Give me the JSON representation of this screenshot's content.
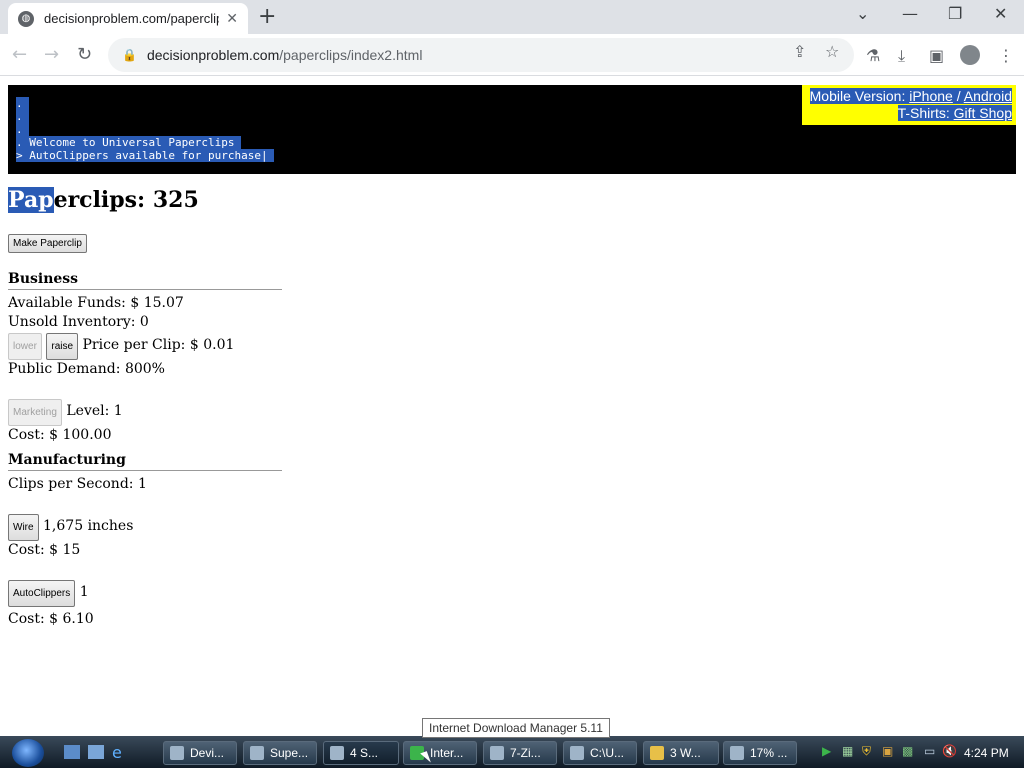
{
  "browser": {
    "tab_title": "decisionproblem.com/paperclips",
    "url_domain": "decisionproblem.com",
    "url_path": "/paperclips/index2.html"
  },
  "console": {
    "lines": [
      ".",
      ".",
      ".",
      ". Welcome to Universal Paperclips",
      "> AutoClippers available for purchase|"
    ]
  },
  "links": {
    "mobile_label": "Mobile Version:",
    "iphone": "iPhone",
    "sep": "/",
    "android": "Android",
    "tshirts_label": "T-Shirts:",
    "gift_shop": "Gift Shop"
  },
  "clips": {
    "label_sel": "Pap",
    "label_rest": "erclips:",
    "count": "325",
    "make_button": "Make Paperclip"
  },
  "business": {
    "title": "Business",
    "funds_label": "Available Funds: $",
    "funds": "15.07",
    "inventory_label": "Unsold Inventory:",
    "inventory": "0",
    "lower_button": "lower",
    "raise_button": "raise",
    "price_label": "Price per Clip: $",
    "price": "0.01",
    "demand_label": "Public Demand:",
    "demand": "800%",
    "marketing_button": "Marketing",
    "level_label": "Level:",
    "level": "1",
    "cost_label": "Cost: $",
    "marketing_cost": "100.00"
  },
  "manufacturing": {
    "title": "Manufacturing",
    "cps_label": "Clips per Second:",
    "cps": "1",
    "wire_button": "Wire",
    "wire_amount": "1,675",
    "wire_unit": "inches",
    "cost_label": "Cost: $",
    "wire_cost": "15",
    "autoclippers_button": "AutoClippers",
    "autoclippers_count": "1",
    "autoclippers_cost": "6.10"
  },
  "taskbar": {
    "items": [
      "Devi...",
      "Supe...",
      "4 S...",
      "Inter...",
      "7-Zi...",
      "C:\\U...",
      "3 W...",
      "17% ..."
    ],
    "tooltip": "Internet Download Manager 5.11",
    "clock": "4:24 PM"
  }
}
